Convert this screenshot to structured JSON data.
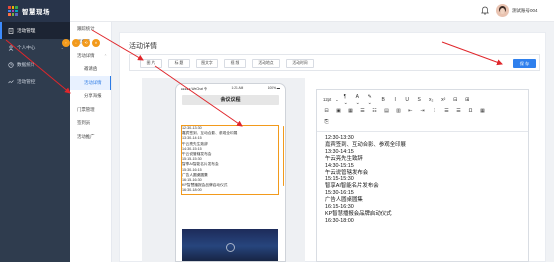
{
  "brand": {
    "name": "智慧现场",
    "logo_colors": [
      "#e94b3c",
      "#f4b400",
      "#34a853",
      "#4285f4",
      "#ab47bc",
      "#00acc1",
      "#ff7043",
      "#7cb342",
      "#5c6bc0"
    ]
  },
  "header": {
    "username": "测试账号004",
    "bell_icon": "bell-icon"
  },
  "sidebar": {
    "items": [
      {
        "label": "活动管理",
        "icon": "document-icon",
        "active": true
      },
      {
        "label": "个人中心",
        "icon": "person-icon",
        "active": false,
        "caret": "⌄"
      },
      {
        "label": "数据统计",
        "icon": "chart-icon",
        "active": false
      },
      {
        "label": "活动管控",
        "icon": "control-icon",
        "active": false
      }
    ]
  },
  "submenu": {
    "items": [
      {
        "label": "跟踪统计",
        "child": false,
        "active": false
      },
      {
        "label": "优惠券",
        "child": false,
        "active": false
      },
      {
        "label": "活动详情",
        "child": false,
        "active": false,
        "caret": "⌃"
      },
      {
        "label": "邀请函",
        "child": true,
        "active": false
      },
      {
        "label": "活动详情",
        "child": true,
        "active": true
      },
      {
        "label": "分享海报",
        "child": true,
        "active": false
      },
      {
        "label": "门票管理",
        "child": false,
        "active": false
      },
      {
        "label": "签到员",
        "child": false,
        "active": false
      },
      {
        "label": "活动推广",
        "child": false,
        "active": false
      }
    ]
  },
  "panel": {
    "title": "活动详情",
    "tools": [
      "图 片",
      "标 题",
      "图文字",
      "视 频",
      "活动地点",
      "活动时间"
    ],
    "save_label": "保 存"
  },
  "phone": {
    "status_left": "●●●●● WeChat 令",
    "status_center": "1:21 AM",
    "status_right": "100% ▬",
    "meeting_title": "会议议程",
    "dot_labels": [
      "↑",
      "↓",
      "⟲",
      "✕"
    ],
    "lines": [
      "12:30-13:30",
      "嘉宾签到、互动合影、参观全印展",
      "13:30-14:15",
      "午云亮先生致辞",
      "14:30-15:15",
      "午云说管辖发布会",
      "15:15-15:30",
      "智享AI智能名片发布会",
      "15:30-16:15",
      "广告人圆桌圆集",
      "16:15-16:30",
      "KP智慧播报会品牌启动仪式",
      "16:30-18:00"
    ]
  },
  "editor": {
    "font_size": "12pt",
    "font_size_caret": "⌄",
    "toolbar_row1": [
      "¶ ⌄",
      "A ⌄",
      "✎ ⌄",
      "B",
      "I",
      "U",
      "S",
      "x₂",
      "x²",
      "⊟",
      "⊞"
    ],
    "toolbar_row2": [
      "⊟",
      "▣",
      "▦",
      "☰",
      "☷",
      "▤",
      "▥",
      "⇤",
      "⇥",
      "⫶",
      "☰",
      "☰",
      "Ω",
      "▦"
    ],
    "toolbar_row3": [
      "⎘"
    ],
    "lines": [
      "12:30-13:30",
      "嘉宾签到、互动合影、参观全印展",
      "13:30-14:15",
      "午云亮先生致辞",
      "14:30-15:15",
      "午云说管辖发布会",
      "15:15-15:30",
      "智享AI智能名片发布会",
      "15:30-16:15",
      "广告人圆桌圆集",
      "16:15-16:30",
      "KP智慧播报会品牌启动仪式",
      "16:30-18:00"
    ]
  },
  "colors": {
    "accent": "#2f80ed",
    "sidebar": "#2f3c4e",
    "highlight": "#f29a1c",
    "arrow": "#e0262b"
  }
}
